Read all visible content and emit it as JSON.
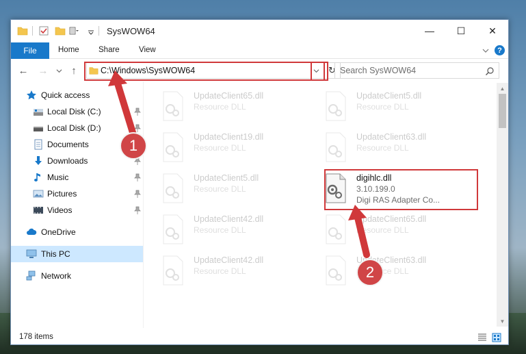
{
  "window": {
    "title": "SysWOW64",
    "controls": {
      "minimize": "—",
      "maximize": "☐",
      "close": "✕"
    }
  },
  "ribbon": {
    "tabs": [
      "File",
      "Home",
      "Share",
      "View"
    ],
    "expand_icon": "chevron-down-icon",
    "help_icon": "?"
  },
  "navigation": {
    "address": "C:\\Windows\\SysWOW64",
    "search_placeholder": "Search SysWOW64"
  },
  "sidebar": {
    "items": [
      {
        "label": "Quick access",
        "icon": "star-icon",
        "pinned": false
      },
      {
        "label": "Local Disk (C:)",
        "icon": "drive-icon",
        "pinned": true
      },
      {
        "label": "Local Disk (D:)",
        "icon": "drive-icon",
        "pinned": true
      },
      {
        "label": "Documents",
        "icon": "documents-icon",
        "pinned": true
      },
      {
        "label": "Downloads",
        "icon": "download-icon",
        "pinned": true
      },
      {
        "label": "Music",
        "icon": "music-icon",
        "pinned": true
      },
      {
        "label": "Pictures",
        "icon": "pictures-icon",
        "pinned": true
      },
      {
        "label": "Videos",
        "icon": "videos-icon",
        "pinned": true
      },
      {
        "label": "OneDrive",
        "icon": "cloud-icon",
        "pinned": false
      },
      {
        "label": "This PC",
        "icon": "computer-icon",
        "pinned": false,
        "selected": true
      },
      {
        "label": "Network",
        "icon": "network-icon",
        "pinned": false
      }
    ]
  },
  "files": [
    {
      "name": "UpdateClient65.dll",
      "sub": "Resource DLL",
      "desc": "",
      "faded": true
    },
    {
      "name": "UpdateClient5.dll",
      "sub": "Resource DLL",
      "desc": "",
      "faded": true
    },
    {
      "name": "UpdateClient19.dll",
      "sub": "Resource DLL",
      "desc": "",
      "faded": true
    },
    {
      "name": "UpdateClient63.dll",
      "sub": "Resource DLL",
      "desc": "",
      "faded": true
    },
    {
      "name": "UpdateClient5.dll",
      "sub": "Resource DLL",
      "desc": "",
      "faded": true
    },
    {
      "name": "digihlc.dll",
      "sub": "3.10.199.0",
      "desc": "Digi RAS Adapter Co...",
      "faded": false
    },
    {
      "name": "UpdateClient42.dll",
      "sub": "Resource DLL",
      "desc": "",
      "faded": true
    },
    {
      "name": "UpdateClient65.dll",
      "sub": "Resource DLL",
      "desc": "",
      "faded": true
    },
    {
      "name": "UpdateClient42.dll",
      "sub": "Resource DLL",
      "desc": "",
      "faded": true
    },
    {
      "name": "UpdateClient63.dll",
      "sub": "Resource DLL",
      "desc": "",
      "faded": true
    }
  ],
  "status": {
    "item_count": "178 items"
  },
  "annotations": {
    "step1": "1",
    "step2": "2"
  },
  "colors": {
    "accent": "#1979ca",
    "highlight": "#d0383a",
    "selection": "#cde8ff"
  }
}
